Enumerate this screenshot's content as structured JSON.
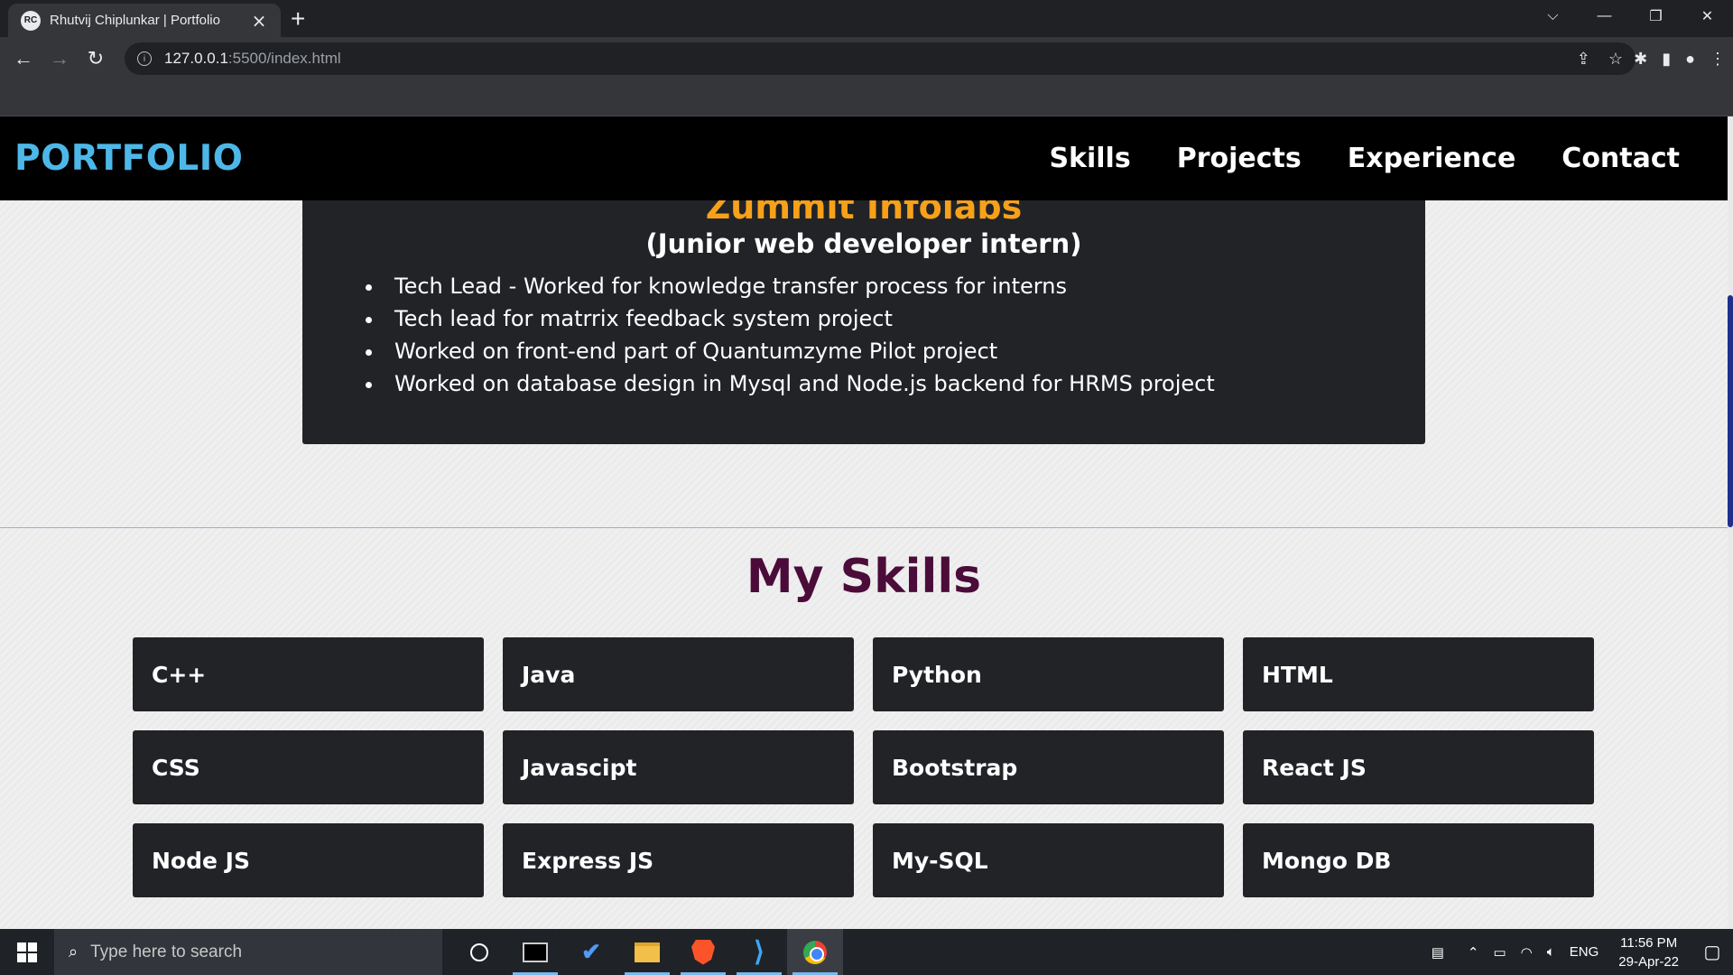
{
  "browser": {
    "tab_title": "Rhutvij Chiplunkar | Portfolio",
    "favicon_text": "RC",
    "url_host": "127.0.0.1",
    "url_path": ":5500/index.html"
  },
  "navbar": {
    "brand": "PORTFOLIO",
    "links": [
      "Skills",
      "Projects",
      "Experience",
      "Contact"
    ]
  },
  "experience": {
    "company": "Zummit Infolabs",
    "role": "(Junior web developer intern)",
    "points": [
      "Tech Lead - Worked for knowledge transfer process for interns",
      "Tech lead for matrrix feedback system project",
      "Worked on front-end part of Quantumzyme Pilot project",
      "Worked on database design in Mysql and Node.js backend for HRMS project"
    ]
  },
  "skills": {
    "title": "My Skills",
    "items": [
      "C++",
      "Java",
      "Python",
      "HTML",
      "CSS",
      "Javascipt",
      "Bootstrap",
      "React JS",
      "Node JS",
      "Express JS",
      "My-SQL",
      "Mongo DB"
    ]
  },
  "taskbar": {
    "search_placeholder": "Type here to search",
    "language": "ENG",
    "time": "11:56 PM",
    "date": "29-Apr-22"
  },
  "colors": {
    "brand": "#4db8e8",
    "company": "#f7a11a",
    "skills_title": "#4b0c39",
    "card_bg": "#212327"
  }
}
